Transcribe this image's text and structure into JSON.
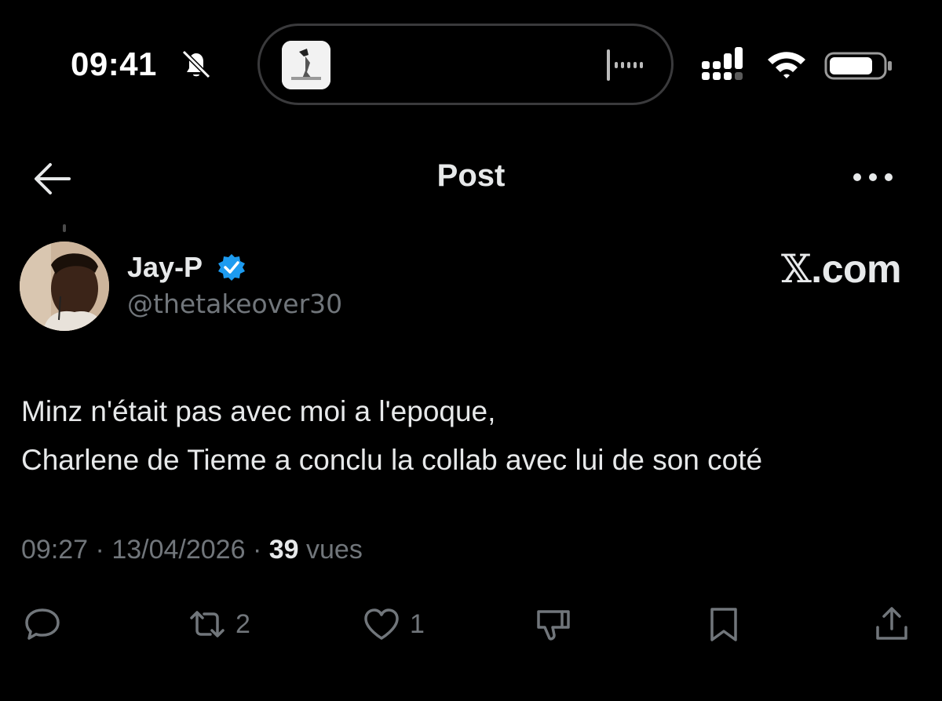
{
  "status_bar": {
    "time": "09:41",
    "icons": [
      "bell-slash-icon",
      "cellular-signal-icon",
      "wifi-icon",
      "battery-icon"
    ]
  },
  "header": {
    "title": "Post",
    "back_icon": "arrow-left-icon",
    "more_icon": "more-horizontal-icon"
  },
  "author": {
    "name": "Jay-P",
    "handle": "@thetakeover30",
    "verified": true
  },
  "brand": {
    "x": "𝕏",
    "text": ".com"
  },
  "post": {
    "lines": [
      "Minz n'était pas avec moi a l'epoque,",
      "Charlene de Tieme a conclu la collab avec lui de son coté"
    ]
  },
  "meta": {
    "time": "09:27",
    "separator": "·",
    "date": "13/04/2026",
    "views_count": "39",
    "views_label": "vues"
  },
  "actions": {
    "reply_count": "",
    "retweet_count": "2",
    "like_count": "1"
  },
  "colors": {
    "background": "#000000",
    "text_primary": "#e7e9ea",
    "text_secondary": "#71767b",
    "verified_blue": "#1d9bf0"
  }
}
